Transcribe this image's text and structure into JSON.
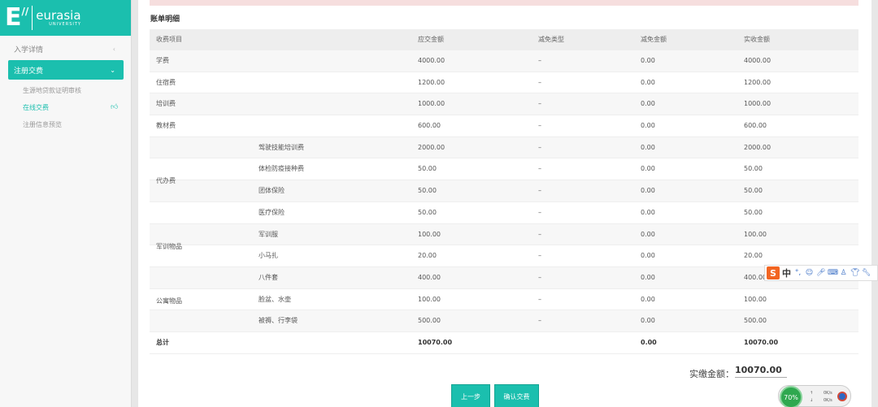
{
  "logo": {
    "mark": "E",
    "slash": "//",
    "name": "eurasia",
    "sub": "UNIVERSITY"
  },
  "sidebar": {
    "items": [
      {
        "label": "入学详情"
      },
      {
        "label": "注册交费"
      }
    ],
    "subitems": [
      {
        "label": "生源地贷款证明审核"
      },
      {
        "label": "在线交费"
      },
      {
        "label": "注册信息预览"
      }
    ]
  },
  "main": {
    "section_title": "账单明细",
    "table": {
      "headers": [
        "收费项目",
        "应交金额",
        "减免类型",
        "减免金额",
        "实收金额"
      ],
      "rows": [
        {
          "group": "学费",
          "item": "",
          "due": "4000.00",
          "type": "–",
          "reduce": "0.00",
          "paid": "4000.00"
        },
        {
          "group": "住宿费",
          "item": "",
          "due": "1200.00",
          "type": "–",
          "reduce": "0.00",
          "paid": "1200.00"
        },
        {
          "group": "培训费",
          "item": "",
          "due": "1000.00",
          "type": "–",
          "reduce": "0.00",
          "paid": "1000.00"
        },
        {
          "group": "教材费",
          "item": "",
          "due": "600.00",
          "type": "–",
          "reduce": "0.00",
          "paid": "600.00"
        },
        {
          "group": "",
          "item": "驾驶技能培训费",
          "due": "2000.00",
          "type": "–",
          "reduce": "0.00",
          "paid": "2000.00"
        },
        {
          "group": "",
          "item": "体检防疫接种费",
          "due": "50.00",
          "type": "–",
          "reduce": "0.00",
          "paid": "50.00"
        },
        {
          "group": "",
          "item": "团体保险",
          "due": "50.00",
          "type": "–",
          "reduce": "0.00",
          "paid": "50.00"
        },
        {
          "group": "",
          "item": "医疗保险",
          "due": "50.00",
          "type": "–",
          "reduce": "0.00",
          "paid": "50.00"
        },
        {
          "group": "",
          "item": "军训服",
          "due": "100.00",
          "type": "–",
          "reduce": "0.00",
          "paid": "100.00"
        },
        {
          "group": "",
          "item": "小马扎",
          "due": "20.00",
          "type": "–",
          "reduce": "0.00",
          "paid": "20.00"
        },
        {
          "group": "",
          "item": "八件套",
          "due": "400.00",
          "type": "–",
          "reduce": "0.00",
          "paid": "400.00"
        },
        {
          "group": "",
          "item": "脸盆、水壶",
          "due": "100.00",
          "type": "–",
          "reduce": "0.00",
          "paid": "100.00"
        },
        {
          "group": "",
          "item": "被褥、行李袋",
          "due": "500.00",
          "type": "–",
          "reduce": "0.00",
          "paid": "500.00"
        }
      ],
      "groups": [
        {
          "label": "代办费"
        },
        {
          "label": "军训物品"
        },
        {
          "label": "公寓物品"
        }
      ],
      "total": {
        "label": "总计",
        "due": "10070.00",
        "reduce": "0.00",
        "paid": "10070.00"
      }
    },
    "actual_label": "实缴金额：",
    "actual_value": "10070.00",
    "buttons": {
      "prev": "上一步",
      "confirm": "确认交费"
    }
  },
  "ime": {
    "logo": "S",
    "lang": "中",
    "icons": [
      "punctuation-icon",
      "emoji-icon",
      "microphone-icon",
      "keyboard-icon",
      "user-icon",
      "shirt-icon",
      "wrench-icon"
    ]
  },
  "speed_widget": {
    "percent": "70%",
    "up": "0K/s",
    "down": "0K/s"
  },
  "colors": {
    "accent": "#1bbfae",
    "alert": "#f6dede"
  }
}
